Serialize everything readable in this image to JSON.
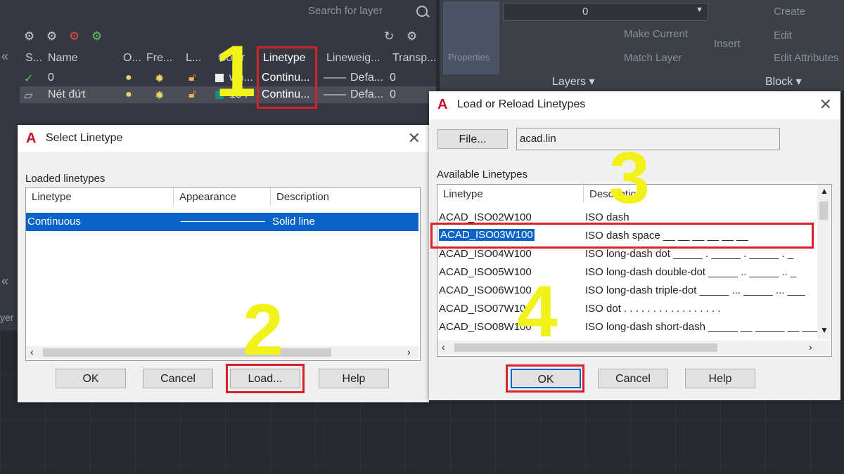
{
  "layers_panel": {
    "search_placeholder": "Search for layer",
    "columns": [
      "S...",
      "Name",
      "O...",
      "Fre...",
      "L...",
      "Color",
      "Linetype",
      "Lineweig...",
      "Transp..."
    ],
    "rows": [
      {
        "name": "0",
        "color": "wh...",
        "linetype": "Continu...",
        "lineweight": "Defa...",
        "transparency": "0"
      },
      {
        "name": "Nét đứt",
        "color": "154",
        "linetype": "Continu...",
        "lineweight": "Defa...",
        "transparency": "0"
      }
    ],
    "collapse": "«",
    "tab_label": "yer"
  },
  "ribbon": {
    "layer_combo_value": "0",
    "buttons": [
      "Make Current",
      "Match Layer",
      "Insert",
      "Create",
      "Edit",
      "Edit Attributes",
      "Properties"
    ],
    "group_layers": "Layers ▾",
    "group_block": "Block ▾"
  },
  "select_linetype": {
    "title": "Select Linetype",
    "section": "Loaded linetypes",
    "columns": [
      "Linetype",
      "Appearance",
      "Description"
    ],
    "rows": [
      {
        "linetype": "Continuous",
        "description": "Solid line"
      }
    ],
    "buttons": {
      "ok": "OK",
      "cancel": "Cancel",
      "load": "Load...",
      "help": "Help"
    }
  },
  "load_linetypes": {
    "title": "Load or Reload Linetypes",
    "file_button": "File...",
    "file_value": "acad.lin",
    "section": "Available Linetypes",
    "columns": [
      "Linetype",
      "Description"
    ],
    "rows": [
      {
        "linetype": "ACAD_ISO02W100",
        "description": "ISO dash"
      },
      {
        "linetype": "ACAD_ISO03W100",
        "description": "ISO dash space __   __   __   __   __   __"
      },
      {
        "linetype": "ACAD_ISO04W100",
        "description": "ISO long-dash dot _____ . _____ . _____ . _"
      },
      {
        "linetype": "ACAD_ISO05W100",
        "description": "ISO long-dash double-dot _____ .. _____ .. _"
      },
      {
        "linetype": "ACAD_ISO06W100",
        "description": "ISO long-dash triple-dot _____ ... _____ ... ___"
      },
      {
        "linetype": "ACAD_ISO07W100",
        "description": "ISO dot . . . . . . . . . . . . . . . . ."
      },
      {
        "linetype": "ACAD_ISO08W100",
        "description": "ISO long-dash short-dash _____ __ _____ __ ___"
      }
    ],
    "buttons": {
      "ok": "OK",
      "cancel": "Cancel",
      "help": "Help"
    }
  },
  "steps": [
    "1",
    "2",
    "3",
    "4"
  ],
  "colors": {
    "highlight_red": "#d6202a",
    "step_yellow": "#f2f21a",
    "selection_blue": "#0a64c8"
  }
}
